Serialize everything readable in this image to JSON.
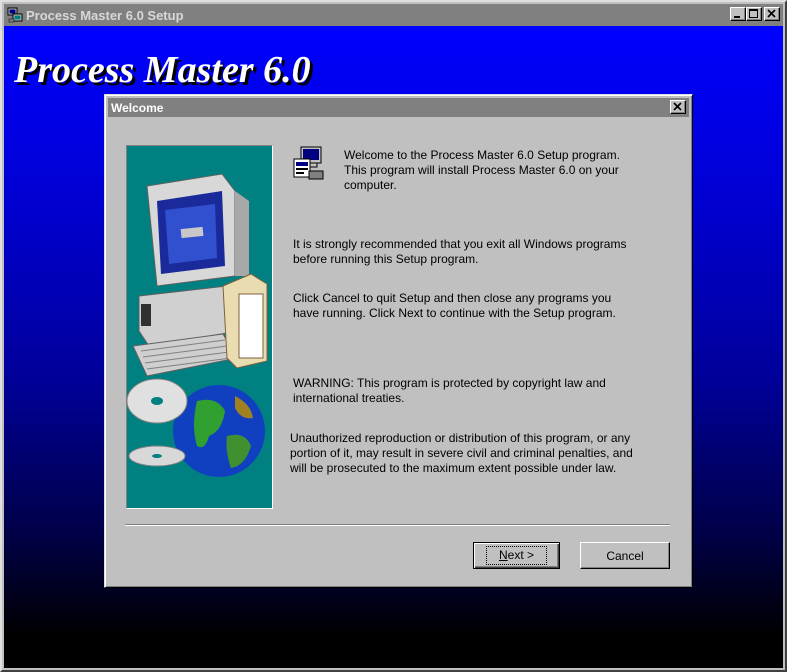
{
  "window": {
    "title": "Process Master 6.0 Setup",
    "controls": [
      "minimize",
      "maximize",
      "close"
    ]
  },
  "background": {
    "heading": "Process Master 6.0"
  },
  "dialog": {
    "title": "Welcome",
    "welcome_text": "Welcome to the Process Master 6.0 Setup program.\nThis program will install Process Master 6.0 on your\ncomputer.",
    "recommend_text": "It is strongly recommended that you exit all Windows programs\nbefore running this Setup program.",
    "cancel_info_text": "Click Cancel to quit Setup and then close any programs you\nhave running.  Click Next to continue with the Setup program.",
    "warning_text": "WARNING: This program is protected by copyright law and\ninternational treaties.",
    "legal_text": "Unauthorized reproduction or distribution of this program, or any\nportion of it, may result in severe civil and criminal penalties, and\nwill be prosecuted to the maximum extent possible under law.",
    "next_button": {
      "label_accel": "N",
      "label_rest": "ext >"
    },
    "cancel_button": {
      "label": "Cancel"
    }
  },
  "icons": {
    "window_icon": "setup-computer-icon",
    "dialog_icon": "setup-program-icon",
    "side_art": "computer-and-globe-illustration"
  },
  "colors": {
    "title_inactive": "#808080",
    "background_gradient_top": "#0000ff",
    "background_gradient_bottom": "#000000",
    "side_panel": "#008080",
    "dialog_face": "#c0c0c0"
  }
}
